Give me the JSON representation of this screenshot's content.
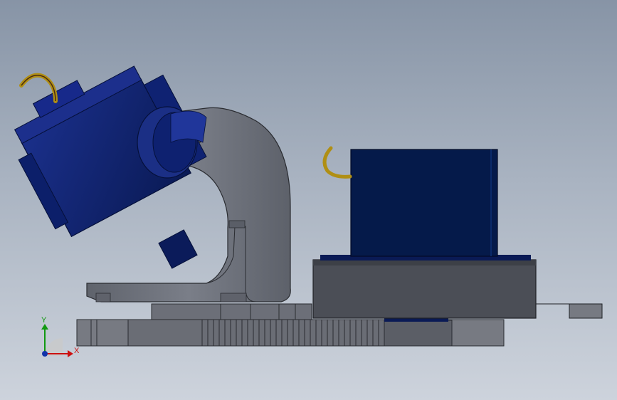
{
  "viewport": {
    "background_top": "#8794a6",
    "background_bottom": "#cdd3dc"
  },
  "colors": {
    "servo_blue": "#0d2470",
    "servo_blue_dark": "#0a1a55",
    "stepper_navy": "#051a4a",
    "bracket_gray": "#6f737d",
    "plate_gray": "#4b4e56",
    "base_gray": "#5b5e66",
    "gear_gray": "#777a82",
    "wire_yellow": "#b08f14",
    "axis_x": "#cc1111",
    "axis_y": "#119911",
    "axis_z": "#1133aa"
  },
  "triad": {
    "x_label": "X",
    "y_label": "Y",
    "icon": "coordinate-triad-icon"
  }
}
